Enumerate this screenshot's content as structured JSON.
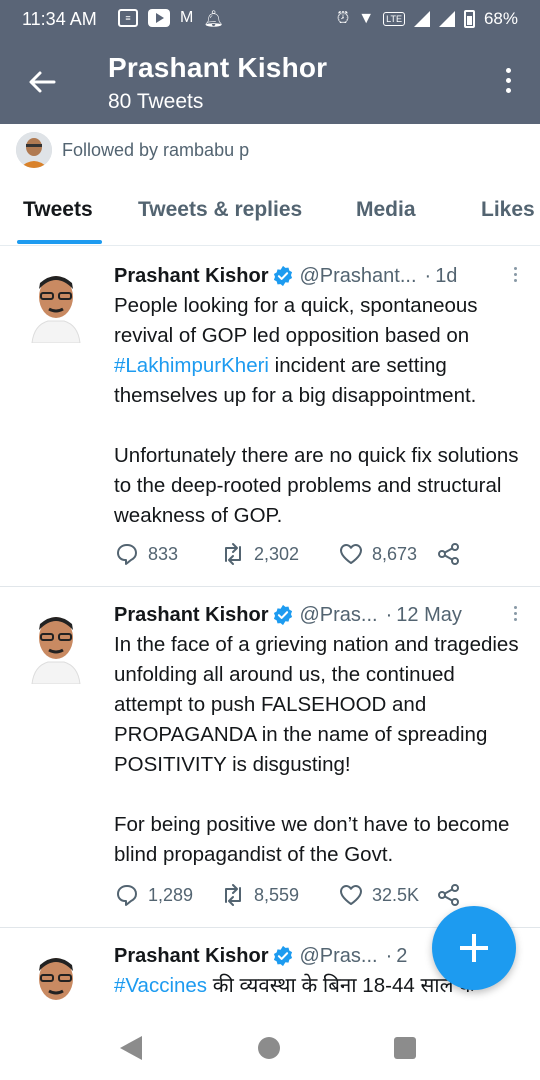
{
  "status_bar": {
    "time": "11:34 AM",
    "battery": "68%",
    "network": "LTE"
  },
  "app_bar": {
    "title": "Prashant Kishor",
    "subtitle": "80 Tweets"
  },
  "followed_by": "Followed by rambabu p",
  "tabs": [
    "Tweets",
    "Tweets & replies",
    "Media",
    "Likes"
  ],
  "active_tab": "Tweets",
  "tweets": [
    {
      "name": "Prashant Kishor",
      "handle": "@Prashant...",
      "time": "1d",
      "text_before": "People looking for a quick, spontaneous revival of GOP led opposition based on ",
      "hashtag": "#LakhimpurKheri",
      "text_after": " incident are setting themselves up for a big disappointment.\n\nUnfortunately there are no quick fix solutions to the deep-rooted problems and structural weakness of GOP.",
      "replies": "833",
      "retweets": "2,302",
      "likes": "8,673"
    },
    {
      "name": "Prashant Kishor",
      "handle": "@Pras...",
      "time": "12 May",
      "text_before": "In the face of a grieving nation and tragedies unfolding all around us, the continued attempt to push FALSEHOOD and PROPAGANDA in the name of spreading POSITIVITY is disgusting!\n\nFor being positive we don’t have to become blind propagandist of the Govt.",
      "replies": "1,289",
      "retweets": "8,559",
      "likes": "32.5K"
    },
    {
      "name": "Prashant Kishor",
      "handle": "@Pras...",
      "time": "2",
      "hashtag": "#Vaccines",
      "text_after": " की व्यवस्था के बिना 18-44 साल के"
    }
  ],
  "colors": {
    "header_bg": "#5a6577",
    "accent": "#1d9bf0",
    "secondary_text": "#536471"
  },
  "icons": [
    "back-arrow-icon",
    "overflow-menu-icon",
    "verified-badge-icon",
    "reply-icon",
    "retweet-icon",
    "like-icon",
    "share-icon",
    "compose-plus-icon"
  ]
}
